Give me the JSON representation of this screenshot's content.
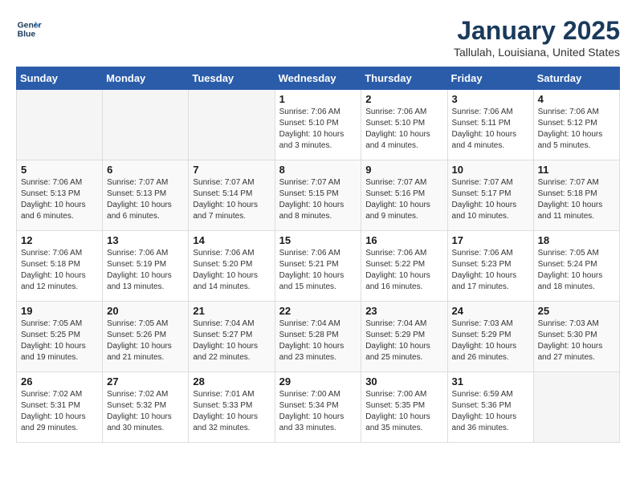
{
  "header": {
    "logo_line1": "General",
    "logo_line2": "Blue",
    "month_title": "January 2025",
    "location": "Tallulah, Louisiana, United States"
  },
  "weekdays": [
    "Sunday",
    "Monday",
    "Tuesday",
    "Wednesday",
    "Thursday",
    "Friday",
    "Saturday"
  ],
  "weeks": [
    [
      {
        "day": "",
        "sunrise": "",
        "sunset": "",
        "daylight": ""
      },
      {
        "day": "",
        "sunrise": "",
        "sunset": "",
        "daylight": ""
      },
      {
        "day": "",
        "sunrise": "",
        "sunset": "",
        "daylight": ""
      },
      {
        "day": "1",
        "sunrise": "Sunrise: 7:06 AM",
        "sunset": "Sunset: 5:10 PM",
        "daylight": "Daylight: 10 hours and 3 minutes."
      },
      {
        "day": "2",
        "sunrise": "Sunrise: 7:06 AM",
        "sunset": "Sunset: 5:10 PM",
        "daylight": "Daylight: 10 hours and 4 minutes."
      },
      {
        "day": "3",
        "sunrise": "Sunrise: 7:06 AM",
        "sunset": "Sunset: 5:11 PM",
        "daylight": "Daylight: 10 hours and 4 minutes."
      },
      {
        "day": "4",
        "sunrise": "Sunrise: 7:06 AM",
        "sunset": "Sunset: 5:12 PM",
        "daylight": "Daylight: 10 hours and 5 minutes."
      }
    ],
    [
      {
        "day": "5",
        "sunrise": "Sunrise: 7:06 AM",
        "sunset": "Sunset: 5:13 PM",
        "daylight": "Daylight: 10 hours and 6 minutes."
      },
      {
        "day": "6",
        "sunrise": "Sunrise: 7:07 AM",
        "sunset": "Sunset: 5:13 PM",
        "daylight": "Daylight: 10 hours and 6 minutes."
      },
      {
        "day": "7",
        "sunrise": "Sunrise: 7:07 AM",
        "sunset": "Sunset: 5:14 PM",
        "daylight": "Daylight: 10 hours and 7 minutes."
      },
      {
        "day": "8",
        "sunrise": "Sunrise: 7:07 AM",
        "sunset": "Sunset: 5:15 PM",
        "daylight": "Daylight: 10 hours and 8 minutes."
      },
      {
        "day": "9",
        "sunrise": "Sunrise: 7:07 AM",
        "sunset": "Sunset: 5:16 PM",
        "daylight": "Daylight: 10 hours and 9 minutes."
      },
      {
        "day": "10",
        "sunrise": "Sunrise: 7:07 AM",
        "sunset": "Sunset: 5:17 PM",
        "daylight": "Daylight: 10 hours and 10 minutes."
      },
      {
        "day": "11",
        "sunrise": "Sunrise: 7:07 AM",
        "sunset": "Sunset: 5:18 PM",
        "daylight": "Daylight: 10 hours and 11 minutes."
      }
    ],
    [
      {
        "day": "12",
        "sunrise": "Sunrise: 7:06 AM",
        "sunset": "Sunset: 5:18 PM",
        "daylight": "Daylight: 10 hours and 12 minutes."
      },
      {
        "day": "13",
        "sunrise": "Sunrise: 7:06 AM",
        "sunset": "Sunset: 5:19 PM",
        "daylight": "Daylight: 10 hours and 13 minutes."
      },
      {
        "day": "14",
        "sunrise": "Sunrise: 7:06 AM",
        "sunset": "Sunset: 5:20 PM",
        "daylight": "Daylight: 10 hours and 14 minutes."
      },
      {
        "day": "15",
        "sunrise": "Sunrise: 7:06 AM",
        "sunset": "Sunset: 5:21 PM",
        "daylight": "Daylight: 10 hours and 15 minutes."
      },
      {
        "day": "16",
        "sunrise": "Sunrise: 7:06 AM",
        "sunset": "Sunset: 5:22 PM",
        "daylight": "Daylight: 10 hours and 16 minutes."
      },
      {
        "day": "17",
        "sunrise": "Sunrise: 7:06 AM",
        "sunset": "Sunset: 5:23 PM",
        "daylight": "Daylight: 10 hours and 17 minutes."
      },
      {
        "day": "18",
        "sunrise": "Sunrise: 7:05 AM",
        "sunset": "Sunset: 5:24 PM",
        "daylight": "Daylight: 10 hours and 18 minutes."
      }
    ],
    [
      {
        "day": "19",
        "sunrise": "Sunrise: 7:05 AM",
        "sunset": "Sunset: 5:25 PM",
        "daylight": "Daylight: 10 hours and 19 minutes."
      },
      {
        "day": "20",
        "sunrise": "Sunrise: 7:05 AM",
        "sunset": "Sunset: 5:26 PM",
        "daylight": "Daylight: 10 hours and 21 minutes."
      },
      {
        "day": "21",
        "sunrise": "Sunrise: 7:04 AM",
        "sunset": "Sunset: 5:27 PM",
        "daylight": "Daylight: 10 hours and 22 minutes."
      },
      {
        "day": "22",
        "sunrise": "Sunrise: 7:04 AM",
        "sunset": "Sunset: 5:28 PM",
        "daylight": "Daylight: 10 hours and 23 minutes."
      },
      {
        "day": "23",
        "sunrise": "Sunrise: 7:04 AM",
        "sunset": "Sunset: 5:29 PM",
        "daylight": "Daylight: 10 hours and 25 minutes."
      },
      {
        "day": "24",
        "sunrise": "Sunrise: 7:03 AM",
        "sunset": "Sunset: 5:29 PM",
        "daylight": "Daylight: 10 hours and 26 minutes."
      },
      {
        "day": "25",
        "sunrise": "Sunrise: 7:03 AM",
        "sunset": "Sunset: 5:30 PM",
        "daylight": "Daylight: 10 hours and 27 minutes."
      }
    ],
    [
      {
        "day": "26",
        "sunrise": "Sunrise: 7:02 AM",
        "sunset": "Sunset: 5:31 PM",
        "daylight": "Daylight: 10 hours and 29 minutes."
      },
      {
        "day": "27",
        "sunrise": "Sunrise: 7:02 AM",
        "sunset": "Sunset: 5:32 PM",
        "daylight": "Daylight: 10 hours and 30 minutes."
      },
      {
        "day": "28",
        "sunrise": "Sunrise: 7:01 AM",
        "sunset": "Sunset: 5:33 PM",
        "daylight": "Daylight: 10 hours and 32 minutes."
      },
      {
        "day": "29",
        "sunrise": "Sunrise: 7:00 AM",
        "sunset": "Sunset: 5:34 PM",
        "daylight": "Daylight: 10 hours and 33 minutes."
      },
      {
        "day": "30",
        "sunrise": "Sunrise: 7:00 AM",
        "sunset": "Sunset: 5:35 PM",
        "daylight": "Daylight: 10 hours and 35 minutes."
      },
      {
        "day": "31",
        "sunrise": "Sunrise: 6:59 AM",
        "sunset": "Sunset: 5:36 PM",
        "daylight": "Daylight: 10 hours and 36 minutes."
      },
      {
        "day": "",
        "sunrise": "",
        "sunset": "",
        "daylight": ""
      }
    ]
  ]
}
